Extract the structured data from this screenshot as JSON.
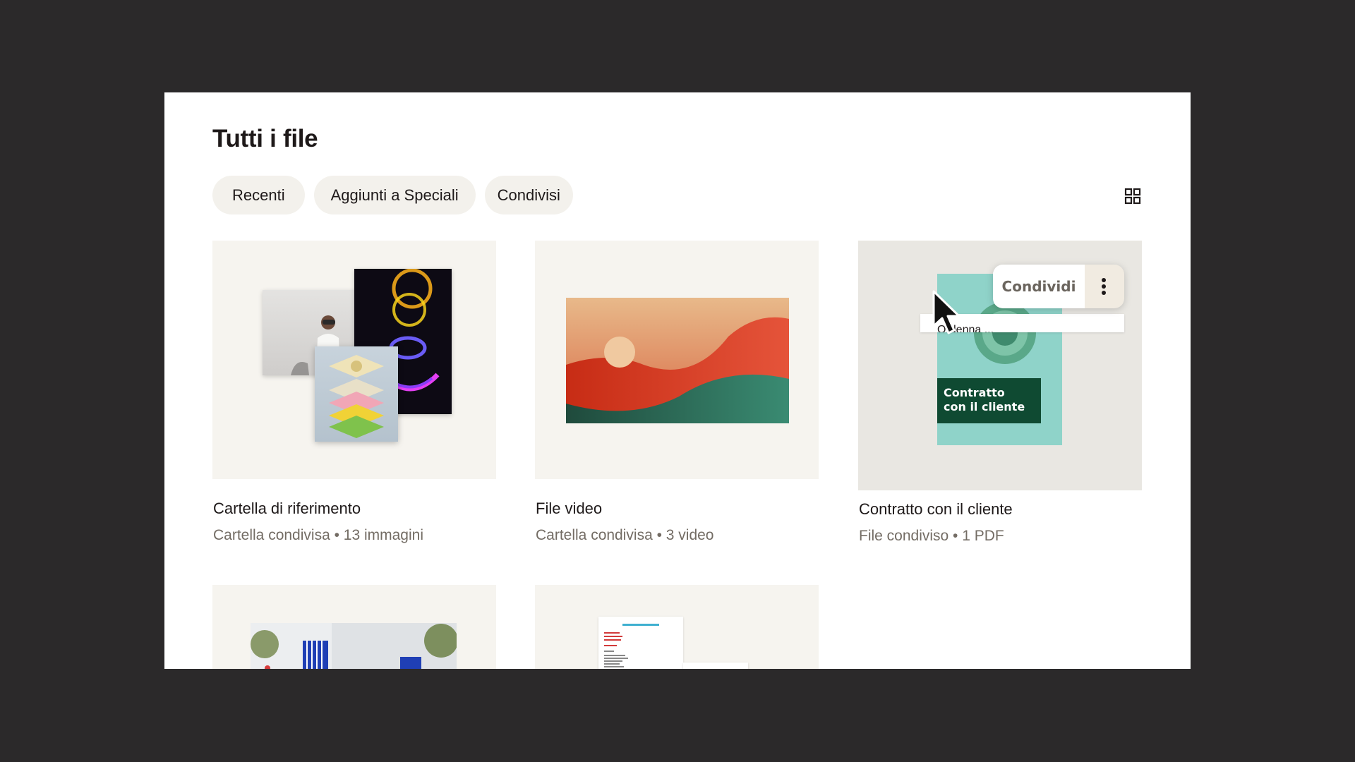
{
  "page": {
    "title": "Tutti i file"
  },
  "filters": [
    {
      "label": "Recenti"
    },
    {
      "label": "Aggiunti a Speciali"
    },
    {
      "label": "Condivisi"
    }
  ],
  "view_toggle": {
    "icon": "grid-view-icon"
  },
  "cards": [
    {
      "title": "Cartella di riferimento",
      "meta": "Cartella condivisa • 13 immagini"
    },
    {
      "title": "File video",
      "meta": "Cartella condivisa • 3 video"
    },
    {
      "title": "Contratto con il cliente",
      "meta": "File condiviso • 1 PDF",
      "thumb_label_line1": "Contratto",
      "thumb_label_line2": "con il cliente"
    },
    {
      "title": "",
      "meta": ""
    },
    {
      "title": "",
      "meta": ""
    }
  ],
  "popover": {
    "share_label": "Condividi",
    "more_icon": "more-vertical-icon",
    "menu_item_partial": "Ordenna ..."
  },
  "colors": {
    "background": "#2b292a",
    "panel": "#ffffff",
    "chip": "#f3f1ec",
    "thumb": "#f6f4ef",
    "text": "#1e1919",
    "muted": "#736c64",
    "contract_bg": "#8fd3c9",
    "contract_label": "#0f4a32"
  }
}
